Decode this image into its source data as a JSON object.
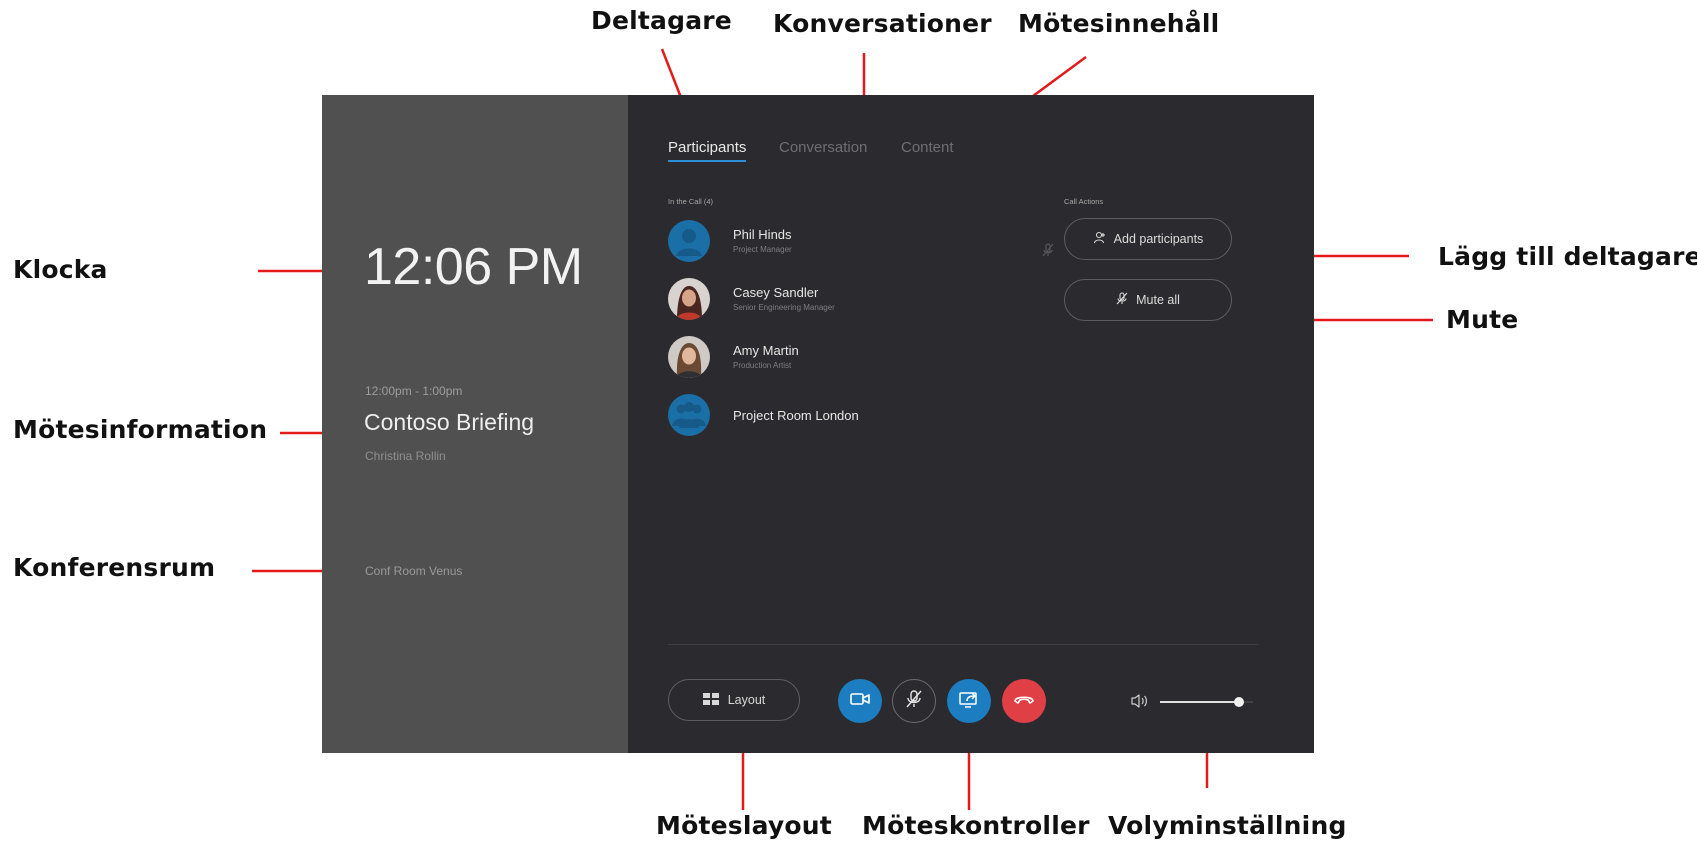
{
  "annotations": {
    "deltagare": "Deltagare",
    "konversationer": "Konversationer",
    "motesinnehall": "Mötesinnehåll",
    "klocka": "Klocka",
    "motesinformation": "Mötesinformation",
    "konferensrum": "Konferensrum",
    "lagg_till_deltagare": "Lägg till deltagare",
    "mute": "Mute",
    "moteslayout": "Möteslayout",
    "moteskontroller": "Möteskontroller",
    "volyminstallning": "Volyminställning"
  },
  "left_panel": {
    "clock": "12:06 PM",
    "meeting_time": "12:00pm - 1:00pm",
    "meeting_title": "Contoso Briefing",
    "meeting_organizer": "Christina Rollin",
    "conference_room": "Conf Room Venus"
  },
  "tabs": [
    {
      "label": "Participants",
      "active": true
    },
    {
      "label": "Conversation",
      "active": false
    },
    {
      "label": "Content",
      "active": false
    }
  ],
  "participants_section": {
    "label": "In the Call (4)",
    "items": [
      {
        "name": "Phil Hinds",
        "role": "Project Manager",
        "avatar": "person-icon"
      },
      {
        "name": "Casey Sandler",
        "role": "Senior Engineering Manager",
        "avatar": "photo"
      },
      {
        "name": "Amy Martin",
        "role": "Production Artist",
        "avatar": "photo"
      },
      {
        "name": "Project Room London",
        "role": "",
        "avatar": "group-icon"
      }
    ]
  },
  "call_actions": {
    "label": "Call Actions",
    "add_participants": "Add participants",
    "mute_all": "Mute all"
  },
  "bottom_bar": {
    "layout_label": "Layout",
    "controls": [
      "video-icon",
      "mic-off-icon",
      "share-screen-icon",
      "hang-up-icon"
    ],
    "volume_level": 0.85
  },
  "colors": {
    "accent": "#1c7ec1",
    "hangup": "#e04045",
    "left_panel_bg": "#515051",
    "right_panel_bg": "#2b2b2f",
    "annotation_arrow": "#e21a1a"
  }
}
